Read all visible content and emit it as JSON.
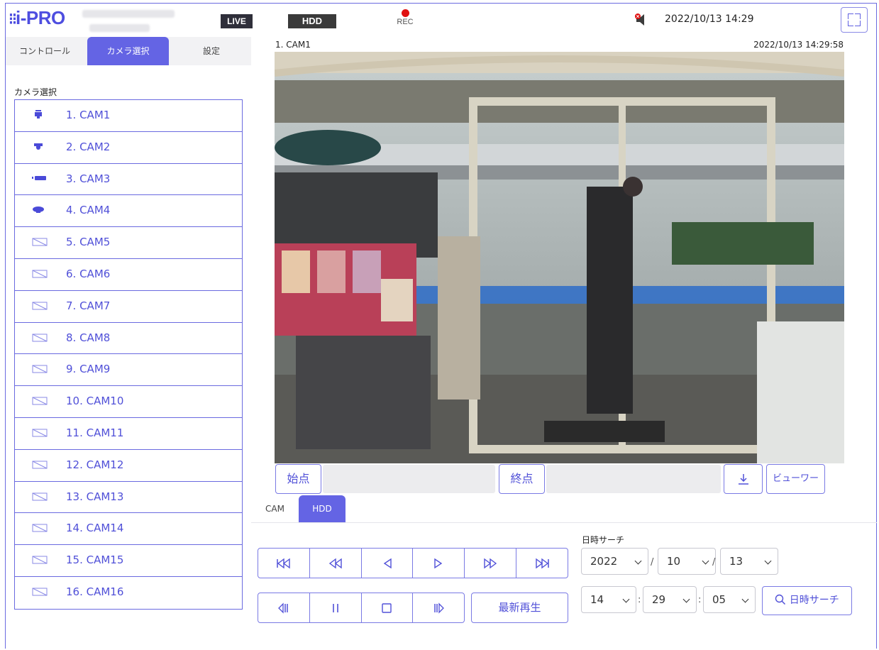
{
  "header": {
    "logo": "i-PRO",
    "live_badge": "LIVE",
    "hdd_badge": "HDD",
    "rec_label": "REC",
    "datetime": "2022/10/13 14:29"
  },
  "left_tabs": [
    "コントロール",
    "カメラ選択",
    "設定"
  ],
  "active_left_tab": "カメラ選択",
  "camera_section_label": "カメラ選択",
  "cameras": [
    {
      "label": "1. CAM1",
      "icon": "box-camera-icon"
    },
    {
      "label": "2. CAM2",
      "icon": "dome-camera-icon"
    },
    {
      "label": "3. CAM3",
      "icon": "bullet-camera-icon"
    },
    {
      "label": "4. CAM4",
      "icon": "fisheye-camera-icon"
    },
    {
      "label": "5. CAM5",
      "icon": "no-camera-icon"
    },
    {
      "label": "6. CAM6",
      "icon": "no-camera-icon"
    },
    {
      "label": "7. CAM7",
      "icon": "no-camera-icon"
    },
    {
      "label": "8. CAM8",
      "icon": "no-camera-icon"
    },
    {
      "label": "9. CAM9",
      "icon": "no-camera-icon"
    },
    {
      "label": "10. CAM10",
      "icon": "no-camera-icon"
    },
    {
      "label": "11. CAM11",
      "icon": "no-camera-icon"
    },
    {
      "label": "12. CAM12",
      "icon": "no-camera-icon"
    },
    {
      "label": "13. CAM13",
      "icon": "no-camera-icon"
    },
    {
      "label": "14. CAM14",
      "icon": "no-camera-icon"
    },
    {
      "label": "15. CAM15",
      "icon": "no-camera-icon"
    },
    {
      "label": "16. CAM16",
      "icon": "no-camera-icon"
    }
  ],
  "video": {
    "camera_label": "1. CAM1",
    "timestamp": "2022/10/13 14:29:58"
  },
  "clip": {
    "start_label": "始点",
    "start_value": "",
    "end_label": "終点",
    "end_value": "",
    "viewer_label": "ビューワー"
  },
  "lower_tabs": [
    "CAM",
    "HDD"
  ],
  "active_lower_tab": "HDD",
  "playback": {
    "latest_play_label": "最新再生"
  },
  "search": {
    "title": "日時サーチ",
    "year": "2022",
    "month": "10",
    "day": "13",
    "hour": "14",
    "minute": "29",
    "second": "05",
    "date_sep": "/",
    "time_sep": ":",
    "button_label": "日時サーチ"
  },
  "colors": {
    "accent": "#6464e4",
    "link": "#5050d8",
    "rec": "#e01010"
  }
}
